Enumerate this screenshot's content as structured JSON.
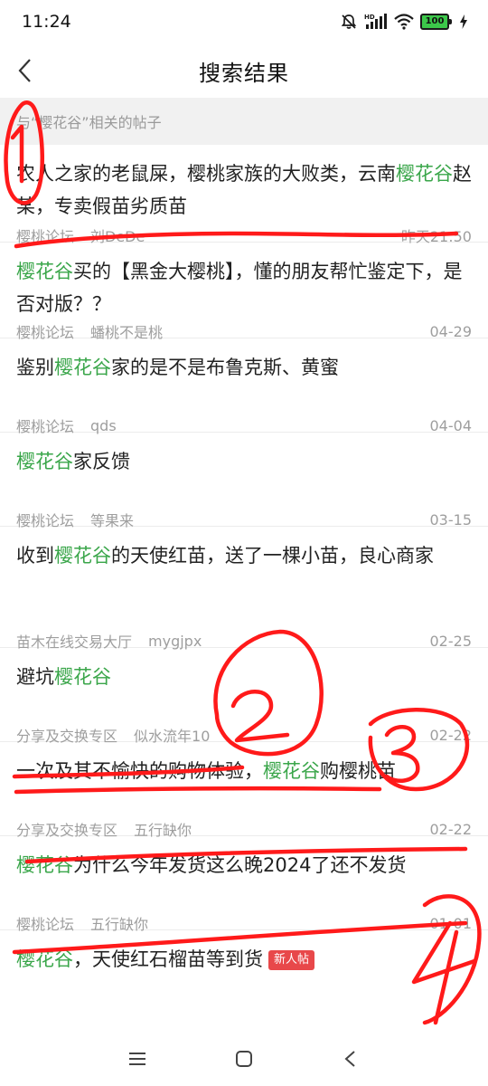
{
  "status_bar": {
    "time": "11:24",
    "battery": "100",
    "icons": [
      "bell-muted-icon",
      "hd-signal-icon",
      "wifi-icon",
      "battery-icon",
      "charging-icon"
    ]
  },
  "header": {
    "title": "搜索结果",
    "back_icon": "chevron-left-icon"
  },
  "section": {
    "label": "与“樱花谷”相关的帖子"
  },
  "highlight_color": "#3aa64a",
  "posts": [
    {
      "title_parts": [
        {
          "text": "农人之家的老鼠屎，樱桃家族的大败类，云南",
          "hl": false
        },
        {
          "text": "樱花谷",
          "hl": true
        },
        {
          "text": "赵某，专卖假苗劣质苗",
          "hl": false
        }
      ],
      "forum": "樱桃论坛",
      "author": "刘DeDe",
      "time": "昨天21:50"
    },
    {
      "title_parts": [
        {
          "text": "樱花谷",
          "hl": true
        },
        {
          "text": "买的【黑金大樱桃】，懂的朋友帮忙鉴定下，是否对版？？",
          "hl": false
        }
      ],
      "forum": "樱桃论坛",
      "author": "蟠桃不是桃",
      "time": "04-29"
    },
    {
      "title_parts": [
        {
          "text": "鉴别",
          "hl": false
        },
        {
          "text": "樱花谷",
          "hl": true
        },
        {
          "text": "家的是不是布鲁克斯、黄蜜",
          "hl": false
        }
      ],
      "forum": "樱桃论坛",
      "author": "qds",
      "time": "04-04"
    },
    {
      "title_parts": [
        {
          "text": "樱花谷",
          "hl": true
        },
        {
          "text": "家反馈",
          "hl": false
        }
      ],
      "forum": "樱桃论坛",
      "author": "等果来",
      "time": "03-15"
    },
    {
      "title_parts": [
        {
          "text": "收到",
          "hl": false
        },
        {
          "text": "樱花谷",
          "hl": true
        },
        {
          "text": "的天使红苗，送了一棵小苗，良心商家",
          "hl": false
        }
      ],
      "forum": "苗木在线交易大厅",
      "author": "mygjpx",
      "time": "02-25"
    },
    {
      "title_parts": [
        {
          "text": "避坑",
          "hl": false
        },
        {
          "text": "樱花谷",
          "hl": true
        }
      ],
      "forum": "分享及交换专区",
      "author": "似水流年10",
      "time": "02-22"
    },
    {
      "title_parts": [
        {
          "text": "一次及其不愉快的购物体验，",
          "hl": false
        },
        {
          "text": "樱花谷",
          "hl": true
        },
        {
          "text": "购樱桃苗",
          "hl": false
        }
      ],
      "forum": "分享及交换专区",
      "author": "五行缺你",
      "time": "02-22"
    },
    {
      "title_parts": [
        {
          "text": "樱花谷",
          "hl": true
        },
        {
          "text": "为什么今年发货这么晚2024了还不发货",
          "hl": false
        }
      ],
      "forum": "樱桃论坛",
      "author": "五行缺你",
      "time": "01-01"
    },
    {
      "title_parts": [
        {
          "text": "樱花谷",
          "hl": true
        },
        {
          "text": "，天使红石榴苗等到货",
          "hl": false
        }
      ],
      "badge": "新人帖",
      "forum": "",
      "author": "",
      "time": ""
    }
  ],
  "nav_bar": {
    "icons": [
      "menu-icon",
      "home-square-icon",
      "back-triangle-icon"
    ]
  },
  "annotations": {
    "color": "#ff0000",
    "labels": [
      "1",
      "2",
      "3",
      "4"
    ]
  }
}
